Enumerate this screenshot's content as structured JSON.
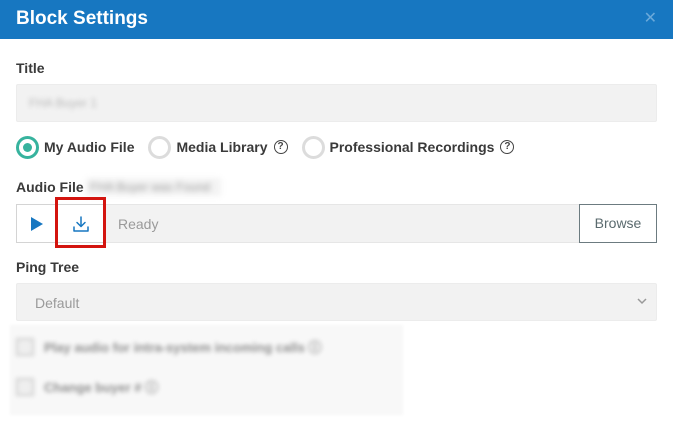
{
  "header": {
    "title": "Block Settings",
    "close_icon": "close-icon"
  },
  "title_field": {
    "label": "Title",
    "value_blurred": "FHA Buyer 1"
  },
  "source_options": [
    {
      "label": "My Audio File",
      "checked": true,
      "help": false
    },
    {
      "label": "Media Library",
      "checked": false,
      "help": true
    },
    {
      "label": "Professional Recordings",
      "checked": false,
      "help": true
    }
  ],
  "help_glyph": "?",
  "audio_file": {
    "label": "Audio File",
    "filename_blurred": "FHA Buyer was Found",
    "play_icon": "play-icon",
    "download_icon": "download-icon",
    "status": "Ready",
    "browse_label": "Browse"
  },
  "ping_tree": {
    "label": "Ping Tree",
    "value": "Default"
  },
  "options": [
    {
      "label": "Play audio for intra-system incoming calls ⓘ"
    },
    {
      "label": "Change buyer # ⓘ"
    }
  ],
  "colors": {
    "header_bg": "#1777c1",
    "radio_checked": "#37b39e",
    "play_icon": "#1777c1",
    "highlight": "#d3140f"
  }
}
